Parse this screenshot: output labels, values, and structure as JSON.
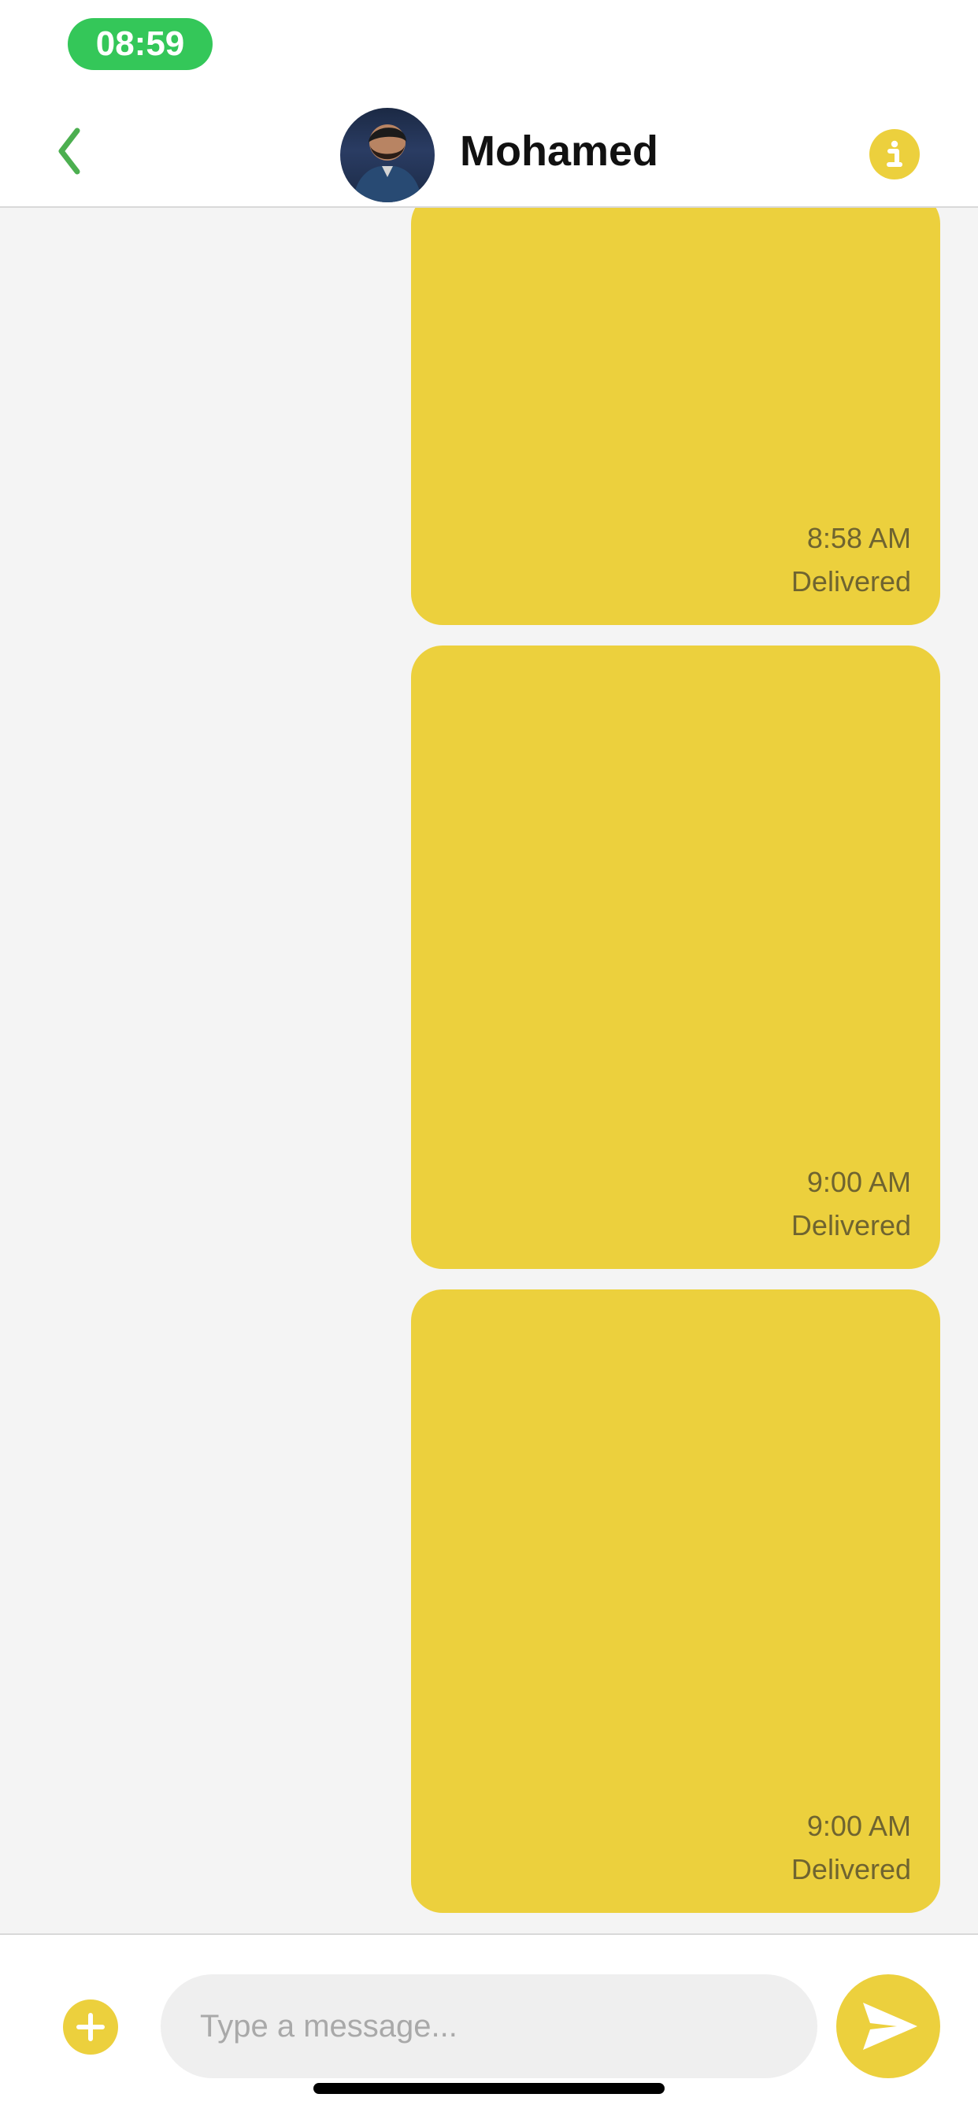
{
  "status_bar": {
    "time": "08:59",
    "accent_color": "#34c759"
  },
  "header": {
    "back_icon": "chevron-left-icon",
    "contact_name": "Mohamed",
    "avatar": "contact-avatar",
    "info_icon": "info-icon",
    "accent_color": "#ecd03d"
  },
  "messages": [
    {
      "time": "8:58 AM",
      "status": "Delivered"
    },
    {
      "time": "9:00 AM",
      "status": "Delivered"
    },
    {
      "time": "9:00 AM",
      "status": "Delivered"
    }
  ],
  "composer": {
    "placeholder": "Type a message...",
    "add_icon": "plus-icon",
    "send_icon": "send-icon"
  },
  "theme": {
    "bubble_color": "#ecd03d",
    "chat_background": "#f4f4f4",
    "header_background": "#ffffff"
  }
}
